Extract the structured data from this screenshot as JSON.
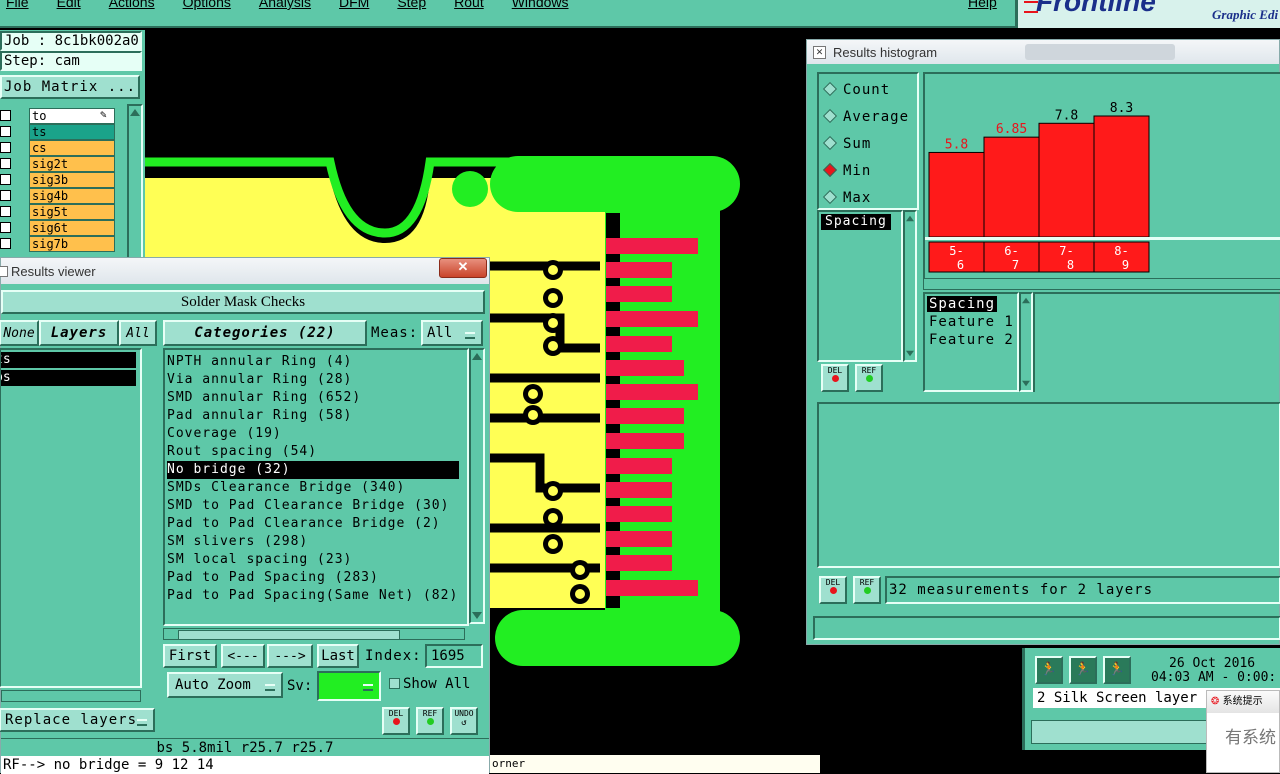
{
  "menu": {
    "items": [
      "File",
      "Edit",
      "Actions",
      "Options",
      "Analysis",
      "DFM",
      "Step",
      "Rout",
      "Windows"
    ],
    "help": "Help"
  },
  "brand": {
    "logo": "Frontline",
    "subtitle": "Graphic Edi"
  },
  "job": {
    "job_label": "Job : 8c1bk002a0",
    "step_label": "Step: cam",
    "matrix_button": "Job Matrix ..."
  },
  "layers": [
    {
      "name": "to",
      "color": "#ffffff"
    },
    {
      "name": "ts",
      "color": "#1aa38a"
    },
    {
      "name": "cs",
      "color": "#ffc04c"
    },
    {
      "name": "sig2t",
      "color": "#ffc04c"
    },
    {
      "name": "sig3b",
      "color": "#ffc04c"
    },
    {
      "name": "sig4b",
      "color": "#ffc04c"
    },
    {
      "name": "sig5t",
      "color": "#ffc04c"
    },
    {
      "name": "sig6t",
      "color": "#ffc04c"
    },
    {
      "name": "sig7b",
      "color": "#ffc04c"
    }
  ],
  "results_viewer": {
    "window_title": "Results viewer",
    "header": "Solder Mask Checks",
    "none_btn": "None",
    "layers_btn": "Layers",
    "all_btn": "All",
    "layer_list": [
      "ts",
      "bs"
    ],
    "categories_btn": "Categories (22)",
    "meas_label": "Meas:",
    "meas_value": "All",
    "categories": [
      "NPTH annular Ring (4)",
      "Via annular Ring (28)",
      "SMD annular Ring (652)",
      "Pad annular Ring (58)",
      "Coverage (19)",
      "Rout spacing (54)",
      "No bridge (32)",
      "SMDs Clearance Bridge (340)",
      "SMD to Pad Clearance Bridge (30)",
      "Pad to Pad Clearance Bridge (2)",
      "SM slivers (298)",
      "SM local spacing (23)",
      "Pad to Pad Spacing (283)",
      "Pad to Pad Spacing(Same Net) (82)"
    ],
    "selected_index": 6,
    "first_btn": "First",
    "prev_btn": "<---",
    "next_btn": "--->",
    "last_btn": "Last",
    "index_label": "Index:",
    "index_value": "1695",
    "zoom_value": "Auto Zoom",
    "sv_label": "Sv:",
    "show_all_label": "Show All",
    "replace_layers": "Replace layers",
    "del_label": "DEL",
    "ref_label": "REF",
    "undo_label": "UNDO",
    "status_line": "bs 5.8mil  r25.7  r25.7",
    "bottom_line": "RF--> no bridge = 9 12 14"
  },
  "histogram": {
    "window_title": "Results histogram",
    "modes": [
      "Count",
      "Average",
      "Sum",
      "Min",
      "Max"
    ],
    "selected_mode": "Min",
    "list_top": [
      "Spacing"
    ],
    "list_bottom": [
      "Spacing",
      "Feature 1",
      "Feature 2"
    ],
    "status": "32 measurements for 2 layers",
    "del_label": "DEL",
    "ref_label": "REF"
  },
  "chart_data": {
    "type": "bar",
    "categories": [
      "5-6",
      "6-7",
      "7-8",
      "8-9"
    ],
    "values": [
      5.8,
      6.85,
      7.8,
      8.3
    ],
    "data_labels": [
      "5.8",
      "6.85",
      "7.8",
      "8.3"
    ],
    "label_colors": [
      "#e8141c",
      "#e8141c",
      "#000000",
      "#000000"
    ],
    "ylim": [
      0,
      8.3
    ],
    "bar_color": "#ff1a1a"
  },
  "lower_right": {
    "date": "26 Oct 2016",
    "time": "04:03 AM - 0:00:",
    "silk_text": "2 Silk Screen layer",
    "notice_title": "系统提示",
    "notice_text": "有系统"
  },
  "canvas_footer": "orner"
}
